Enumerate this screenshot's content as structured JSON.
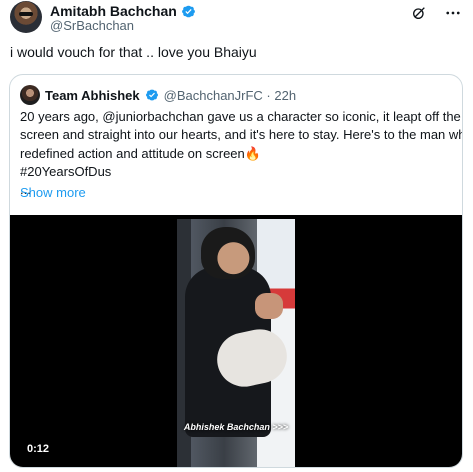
{
  "author": {
    "display_name": "Amitabh Bachchan",
    "handle": "@SrBachchan"
  },
  "tweet": {
    "text": "i would vouch for that .. love you Bhaiyu"
  },
  "quoted": {
    "display_name": "Team Abhishek",
    "handle_time": "@BachchanJrFC · 22h",
    "body_lines": [
      "20 years ago, @juniorbachchan gave us a character so iconic, it leapt off the",
      "screen and straight into our hearts, and it's here to stay. Here's to the man who",
      "redefined action and attitude on screen🔥",
      "#20YearsOfDus",
      "..."
    ],
    "show_more": "Show more",
    "video": {
      "caption": "Abhishek Bachchan >>>",
      "duration": "0:12"
    }
  },
  "icons": {
    "verified": "verified-badge-icon",
    "grok": "grok-icon",
    "more": "more-options-icon"
  },
  "colors": {
    "verified_blue": "#1d9bf0",
    "link_blue": "#1d9bf0",
    "secondary_text": "#536471",
    "border": "#cfd9de"
  }
}
